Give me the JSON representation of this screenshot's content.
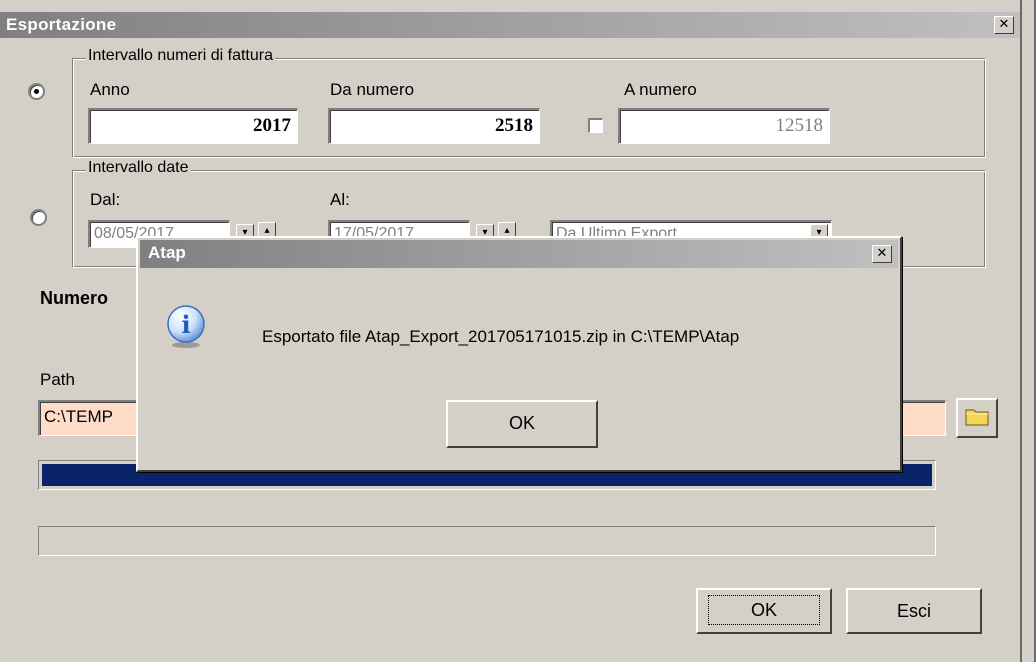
{
  "window": {
    "title": "Esportazione",
    "close_glyph": "✕"
  },
  "invoice_range": {
    "legend": "Intervallo numeri di fattura",
    "selected": true,
    "year_label": "Anno",
    "year_value": "2017",
    "from_label": "Da numero",
    "from_value": "2518",
    "to_label": "A numero",
    "to_value": "12518",
    "to_checked": false
  },
  "date_range": {
    "legend": "Intervallo date",
    "selected": false,
    "from_label": "Dal:",
    "from_value": "08/05/2017",
    "to_label": "Al:",
    "to_value": "17/05/2017",
    "preset_value": "Da Ultimo Export"
  },
  "numero_label": "Numero",
  "path_label": "Path",
  "path_value": "C:\\TEMP",
  "progress_1": 1.0,
  "progress_2": 0.0,
  "buttons": {
    "ok": "OK",
    "exit": "Esci"
  },
  "dialog": {
    "title": "Atap",
    "message": "Esportato file Atap_Export_201705171015.zip in  C:\\TEMP\\Atap",
    "ok": "OK",
    "close_glyph": "✕",
    "info_glyph": "i"
  },
  "colors": {
    "progress_fill": "#0a246a",
    "path_bg": "#ffdcc8",
    "info_blue": "#1a5fbf"
  }
}
